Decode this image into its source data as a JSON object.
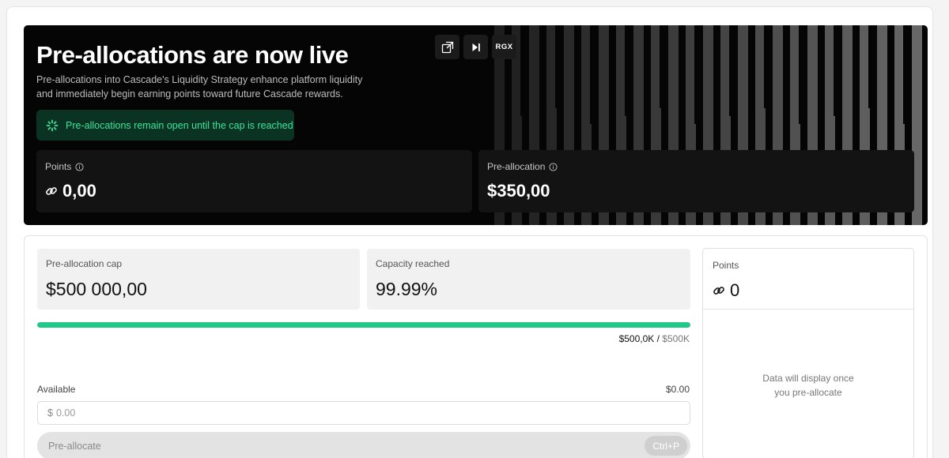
{
  "hero": {
    "title": "Pre-allocations are now live",
    "description_line1": "Pre-allocations into Cascade's Liquidity Strategy enhance platform liquidity",
    "description_line2": "and immediately begin earning points toward future Cascade rewards.",
    "notice": "Pre-allocations remain open until the cap is reached",
    "toolbar": {
      "rgx_label": "RGX"
    },
    "points": {
      "label": "Points",
      "value": "0,00"
    },
    "preallocation": {
      "label": "Pre-allocation",
      "value": "$350,00"
    }
  },
  "cap": {
    "label": "Pre-allocation cap",
    "value": "$500 000,00"
  },
  "capacity": {
    "label": "Capacity reached",
    "value": "99.99%",
    "fraction": 0.9999
  },
  "progress": {
    "current": "$500,0K",
    "separator": " / ",
    "max": "$500K"
  },
  "available": {
    "label": "Available",
    "value": "$0.00"
  },
  "amount_input": {
    "currency": "$",
    "placeholder": "0.00"
  },
  "preallocate_button": {
    "label": "Pre-allocate",
    "shortcut": "Ctrl+P"
  },
  "side_panel": {
    "label": "Points",
    "value": "0",
    "empty_line1": "Data will display once",
    "empty_line2": "you pre-allocate"
  },
  "colors": {
    "accent_green": "#20c98a",
    "notice_green": "#3be49a",
    "hero_bg": "#050505"
  }
}
